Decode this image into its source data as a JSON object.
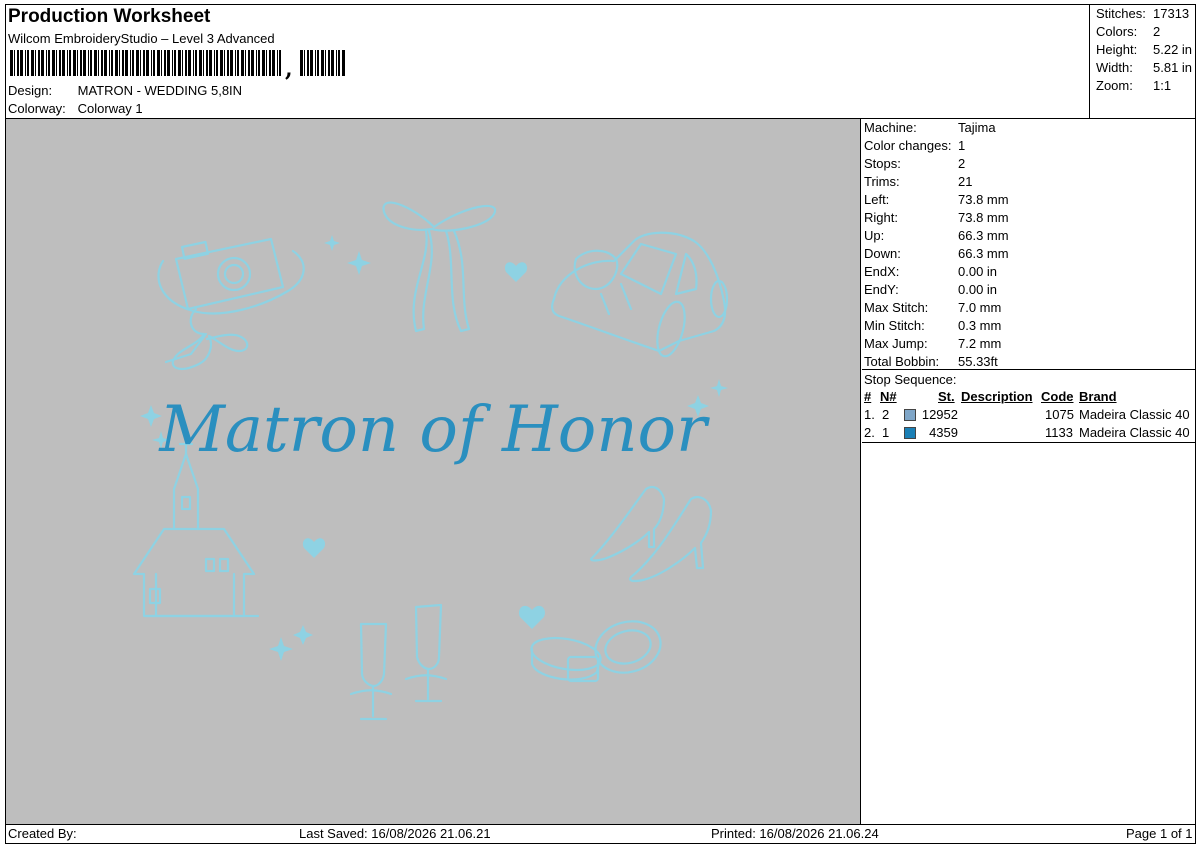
{
  "header": {
    "title": "Production Worksheet",
    "subtitle": "Wilcom EmbroideryStudio – Level 3 Advanced",
    "barcode_label": "barcode",
    "design_label": "Design:",
    "design_value": "MATRON - WEDDING 5,8IN",
    "colorway_label": "Colorway:",
    "colorway_value": "Colorway 1"
  },
  "stats": {
    "stitches_label": "Stitches:",
    "stitches": "17313",
    "colors_label": "Colors:",
    "colors": "2",
    "height_label": "Height:",
    "height": "5.22 in",
    "width_label": "Width:",
    "width": "5.81 in",
    "zoom_label": "Zoom:",
    "zoom": "1:1"
  },
  "machine_info": [
    {
      "label": "Machine:",
      "value": "Tajima"
    },
    {
      "label": "Color changes:",
      "value": "1"
    },
    {
      "label": "Stops:",
      "value": "2"
    },
    {
      "label": "Trims:",
      "value": "21"
    },
    {
      "label": "Left:",
      "value": "73.8 mm"
    },
    {
      "label": "Right:",
      "value": "73.8 mm"
    },
    {
      "label": "Up:",
      "value": "66.3 mm"
    },
    {
      "label": "Down:",
      "value": "66.3 mm"
    },
    {
      "label": "EndX:",
      "value": "0.00 in"
    },
    {
      "label": "EndY:",
      "value": "0.00 in"
    },
    {
      "label": "Max Stitch:",
      "value": "7.0 mm"
    },
    {
      "label": "Min Stitch:",
      "value": "0.3 mm"
    },
    {
      "label": "Max Jump:",
      "value": "7.2 mm"
    },
    {
      "label": "Total Bobbin:",
      "value": "55.33ft"
    }
  ],
  "stop_sequence": {
    "title": "Stop Sequence:",
    "headers": {
      "num": "#",
      "n": "N#",
      "st": "St.",
      "description": "Description",
      "code": "Code",
      "brand": "Brand"
    },
    "rows": [
      {
        "num": "1.",
        "n": "2",
        "color": "#7fa6c8",
        "st": "12952",
        "description": "",
        "code": "1075",
        "brand": "Madeira Classic 40"
      },
      {
        "num": "2.",
        "n": "1",
        "color": "#1a7fb5",
        "st": "4359",
        "description": "",
        "code": "1133",
        "brand": "Madeira Classic 40"
      }
    ]
  },
  "design": {
    "text": "Matron of Honor",
    "background": "#bebebe",
    "text_color": "#2a8fbf",
    "line_color": "#8ed2e3"
  },
  "footer": {
    "created_by": "Created By:",
    "last_saved": "Last Saved: 16/08/2026 21.06.21",
    "printed": "Printed: 16/08/2026 21.06.24",
    "page": "Page 1 of 1"
  }
}
